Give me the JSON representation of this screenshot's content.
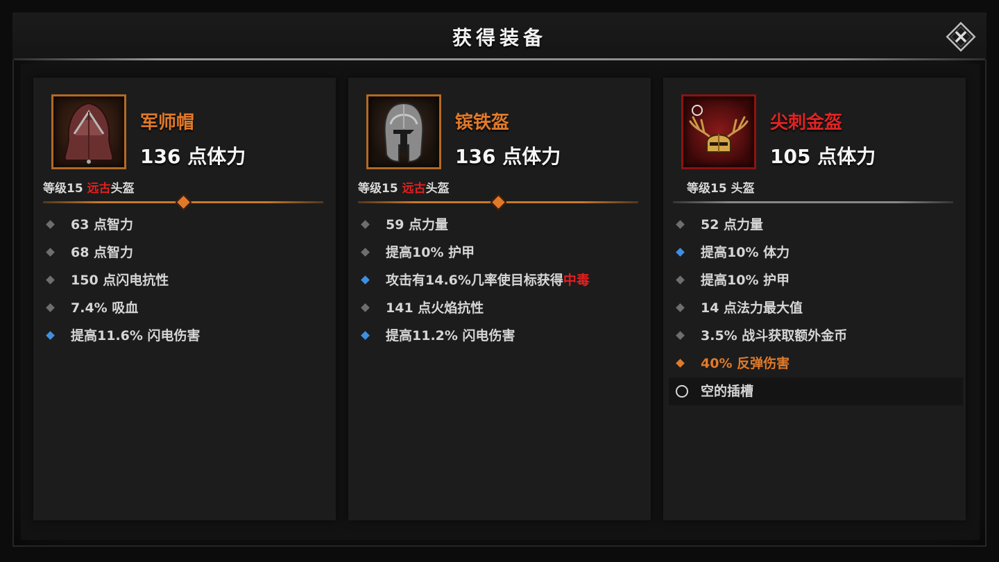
{
  "window": {
    "title": "获得装备"
  },
  "close": {
    "icon": "close-icon"
  },
  "items": [
    {
      "name": "军师帽",
      "name_color": "#e07a2a",
      "main_stat": "136 点体力",
      "level": "等级15",
      "rarity": "远古",
      "slot": "头盔",
      "icon": "hood-icon",
      "stats": [
        {
          "text": "63 点智力",
          "bullet": "gray"
        },
        {
          "text": "68 点智力",
          "bullet": "gray"
        },
        {
          "text": "150 点闪电抗性",
          "bullet": "gray"
        },
        {
          "text": "7.4% 吸血",
          "bullet": "gray"
        },
        {
          "text": "提高11.6% 闪电伤害",
          "bullet": "blue"
        }
      ]
    },
    {
      "name": "镔铁盔",
      "name_color": "#e07a2a",
      "main_stat": "136 点体力",
      "level": "等级15",
      "rarity": "远古",
      "slot": "头盔",
      "icon": "iron-helmet-icon",
      "stats": [
        {
          "text": "59 点力量",
          "bullet": "gray"
        },
        {
          "text": "提高10% 护甲",
          "bullet": "blue-hidden"
        },
        {
          "text": "攻击有14.6%几率使目标获得",
          "highlight": "中毒",
          "bullet": "blue"
        },
        {
          "text": "141 点火焰抗性",
          "bullet": "gray"
        },
        {
          "text": "提高11.2% 闪电伤害",
          "bullet": "blue"
        }
      ]
    },
    {
      "name": "尖刺金盔",
      "name_color": "#e02424",
      "main_stat": "105 点体力",
      "level": "等级15",
      "slot": "头盔",
      "icon": "antler-helmet-icon",
      "stats": [
        {
          "text": "52 点力量",
          "bullet": "gray"
        },
        {
          "text": "提高10% 体力",
          "bullet": "blue"
        },
        {
          "text": "提高10% 护甲",
          "bullet": "gray"
        },
        {
          "text": "14 点法力最大值",
          "bullet": "gray"
        },
        {
          "text": "3.5% 战斗获取额外金币",
          "bullet": "gray"
        },
        {
          "text": "40% 反弹伤害",
          "bullet": "orange"
        },
        {
          "text": "空的插槽",
          "bullet": "socket"
        }
      ]
    }
  ]
}
